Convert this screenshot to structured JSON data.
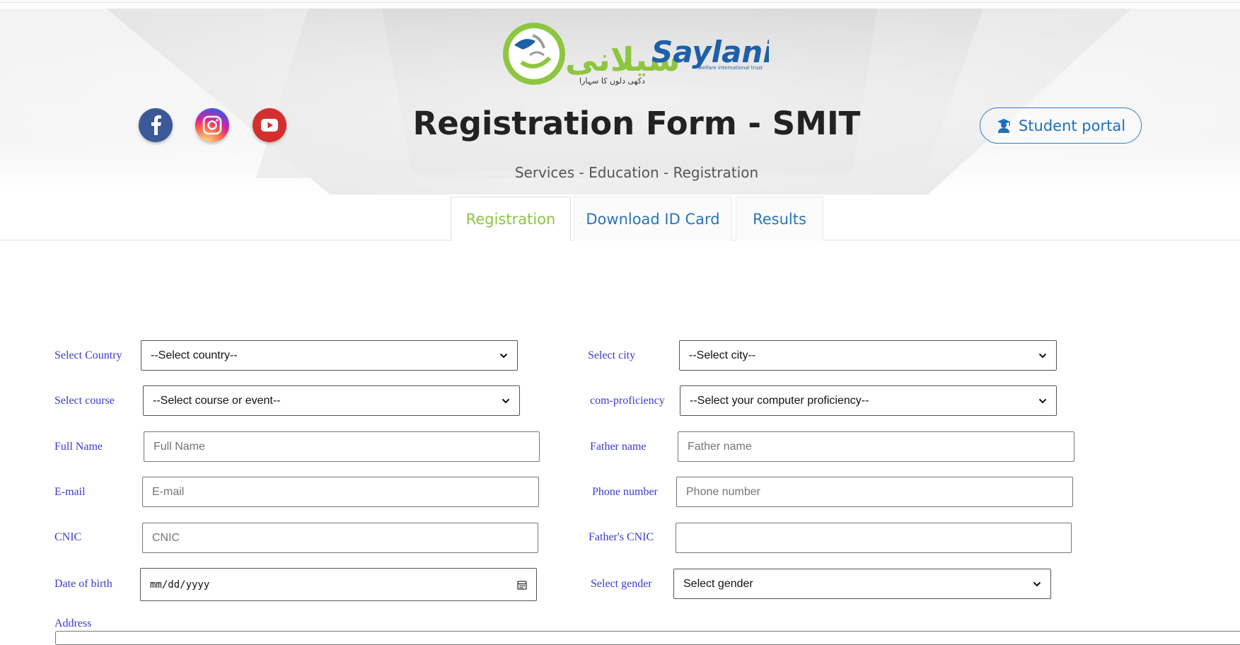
{
  "header": {
    "logo": {
      "urdu": "سیلانی",
      "english": "Saylani",
      "tagline": "welfare international trust",
      "urdu_tagline": "دکھی دلوں کا سہارا"
    },
    "title": "Registration Form - SMIT",
    "subtitle": "Services - Education - Registration",
    "portal_button": "Student portal",
    "social": [
      "facebook-icon",
      "instagram-icon",
      "youtube-icon"
    ]
  },
  "tabs": [
    {
      "label": "Registration",
      "active": true
    },
    {
      "label": "Download ID Card",
      "active": false
    },
    {
      "label": "Results",
      "active": false
    }
  ],
  "form": {
    "country": {
      "label": "Select Country",
      "value": "--Select country--"
    },
    "city": {
      "label": "Select city",
      "value": "--Select city--"
    },
    "course": {
      "label": "Select course",
      "value": "--Select course or event--"
    },
    "proficiency": {
      "label": "com-proficiency",
      "value": "--Select your computer proficiency--"
    },
    "full_name": {
      "label": "Full Name",
      "placeholder": "Full Name"
    },
    "father_name": {
      "label": "Father name",
      "placeholder": "Father name"
    },
    "email": {
      "label": "E-mail",
      "placeholder": "E-mail"
    },
    "phone": {
      "label": "Phone number",
      "placeholder": "Phone number"
    },
    "cnic": {
      "label": "CNIC",
      "placeholder": "CNIC"
    },
    "father_cnic": {
      "label": "Father's CNIC",
      "placeholder": ""
    },
    "dob": {
      "label": "Date of birth",
      "value": "mm/dd/yyyy"
    },
    "gender": {
      "label": "Select gender",
      "value": "Select gender"
    },
    "address": {
      "label": "Address"
    }
  },
  "colors": {
    "label": "#3a3ad0",
    "accent_green": "#8dc63f",
    "link_blue": "#2a73b8"
  }
}
